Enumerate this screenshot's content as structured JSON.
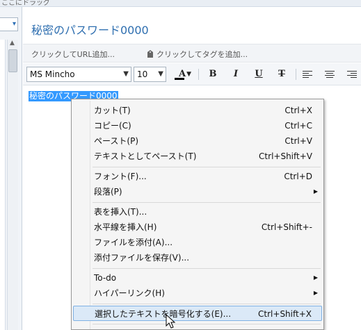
{
  "top": {
    "hint": "ここにドラッグ"
  },
  "note": {
    "title": "秘密のパスワード0000"
  },
  "meta": {
    "url_placeholder": "クリックしてURL追加...",
    "tag_placeholder": "クリックしてタグを追加..."
  },
  "toolbar": {
    "font": "MS Mincho",
    "size": "10",
    "color_letter": "A",
    "bold": "B",
    "italic": "I",
    "underline": "U",
    "strike": "T"
  },
  "editor": {
    "selected_text": "秘密のパスワード0000"
  },
  "menu": {
    "items": [
      {
        "label": "カット(T)",
        "shortcut": "Ctrl+X"
      },
      {
        "label": "コピー(C)",
        "shortcut": "Ctrl+C"
      },
      {
        "label": "ペースト(P)",
        "shortcut": "Ctrl+V"
      },
      {
        "label": "テキストとしてペースト(T)",
        "shortcut": "Ctrl+Shift+V"
      },
      {
        "label": "フォント(F)...",
        "shortcut": "Ctrl+D"
      },
      {
        "label": "段落(P)",
        "shortcut": ""
      },
      {
        "label": "表を挿入(T)...",
        "shortcut": ""
      },
      {
        "label": "水平線を挿入(H)",
        "shortcut": "Ctrl+Shift+-"
      },
      {
        "label": "ファイルを添付(A)...",
        "shortcut": ""
      },
      {
        "label": "添付ファイルを保存(V)...",
        "shortcut": ""
      },
      {
        "label": "To-do",
        "shortcut": ""
      },
      {
        "label": "ハイパーリンク(H)",
        "shortcut": ""
      },
      {
        "label": "選択したテキストを暗号化する(E)...",
        "shortcut": "Ctrl+Shift+X"
      }
    ]
  },
  "colors": {
    "accent": "#2f6fb0",
    "selection": "#3399ff",
    "menu_highlight": "#dbe9f7"
  }
}
